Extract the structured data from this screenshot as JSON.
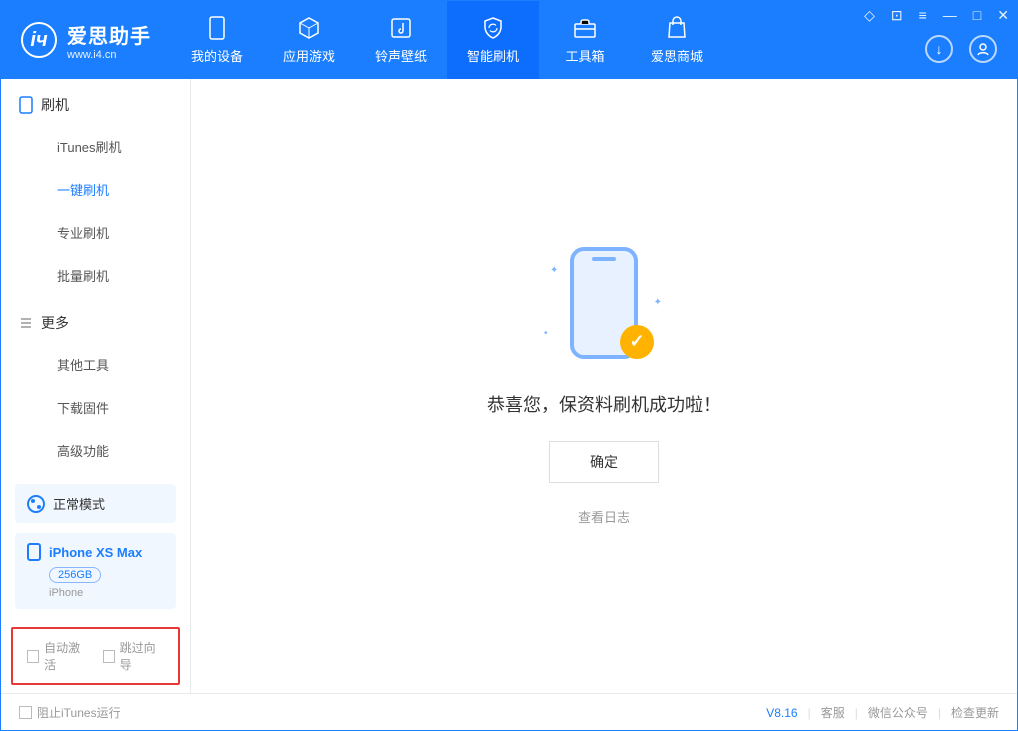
{
  "logo": {
    "title": "爱思助手",
    "subtitle": "www.i4.cn"
  },
  "nav": {
    "items": [
      {
        "label": "我的设备"
      },
      {
        "label": "应用游戏"
      },
      {
        "label": "铃声壁纸"
      },
      {
        "label": "智能刷机"
      },
      {
        "label": "工具箱"
      },
      {
        "label": "爱思商城"
      }
    ]
  },
  "sidebar": {
    "section1": {
      "title": "刷机",
      "items": [
        {
          "label": "iTunes刷机"
        },
        {
          "label": "一键刷机"
        },
        {
          "label": "专业刷机"
        },
        {
          "label": "批量刷机"
        }
      ]
    },
    "section2": {
      "title": "更多",
      "items": [
        {
          "label": "其他工具"
        },
        {
          "label": "下载固件"
        },
        {
          "label": "高级功能"
        }
      ]
    },
    "mode": {
      "label": "正常模式"
    },
    "device": {
      "name": "iPhone XS Max",
      "storage": "256GB",
      "type": "iPhone"
    },
    "checkboxes": {
      "auto_activate": "自动激活",
      "skip_guide": "跳过向导"
    }
  },
  "main": {
    "success_text": "恭喜您，保资料刷机成功啦！",
    "ok_button": "确定",
    "log_link": "查看日志"
  },
  "footer": {
    "block_itunes": "阻止iTunes运行",
    "version": "V8.16",
    "links": {
      "service": "客服",
      "wechat": "微信公众号",
      "update": "检查更新"
    }
  }
}
